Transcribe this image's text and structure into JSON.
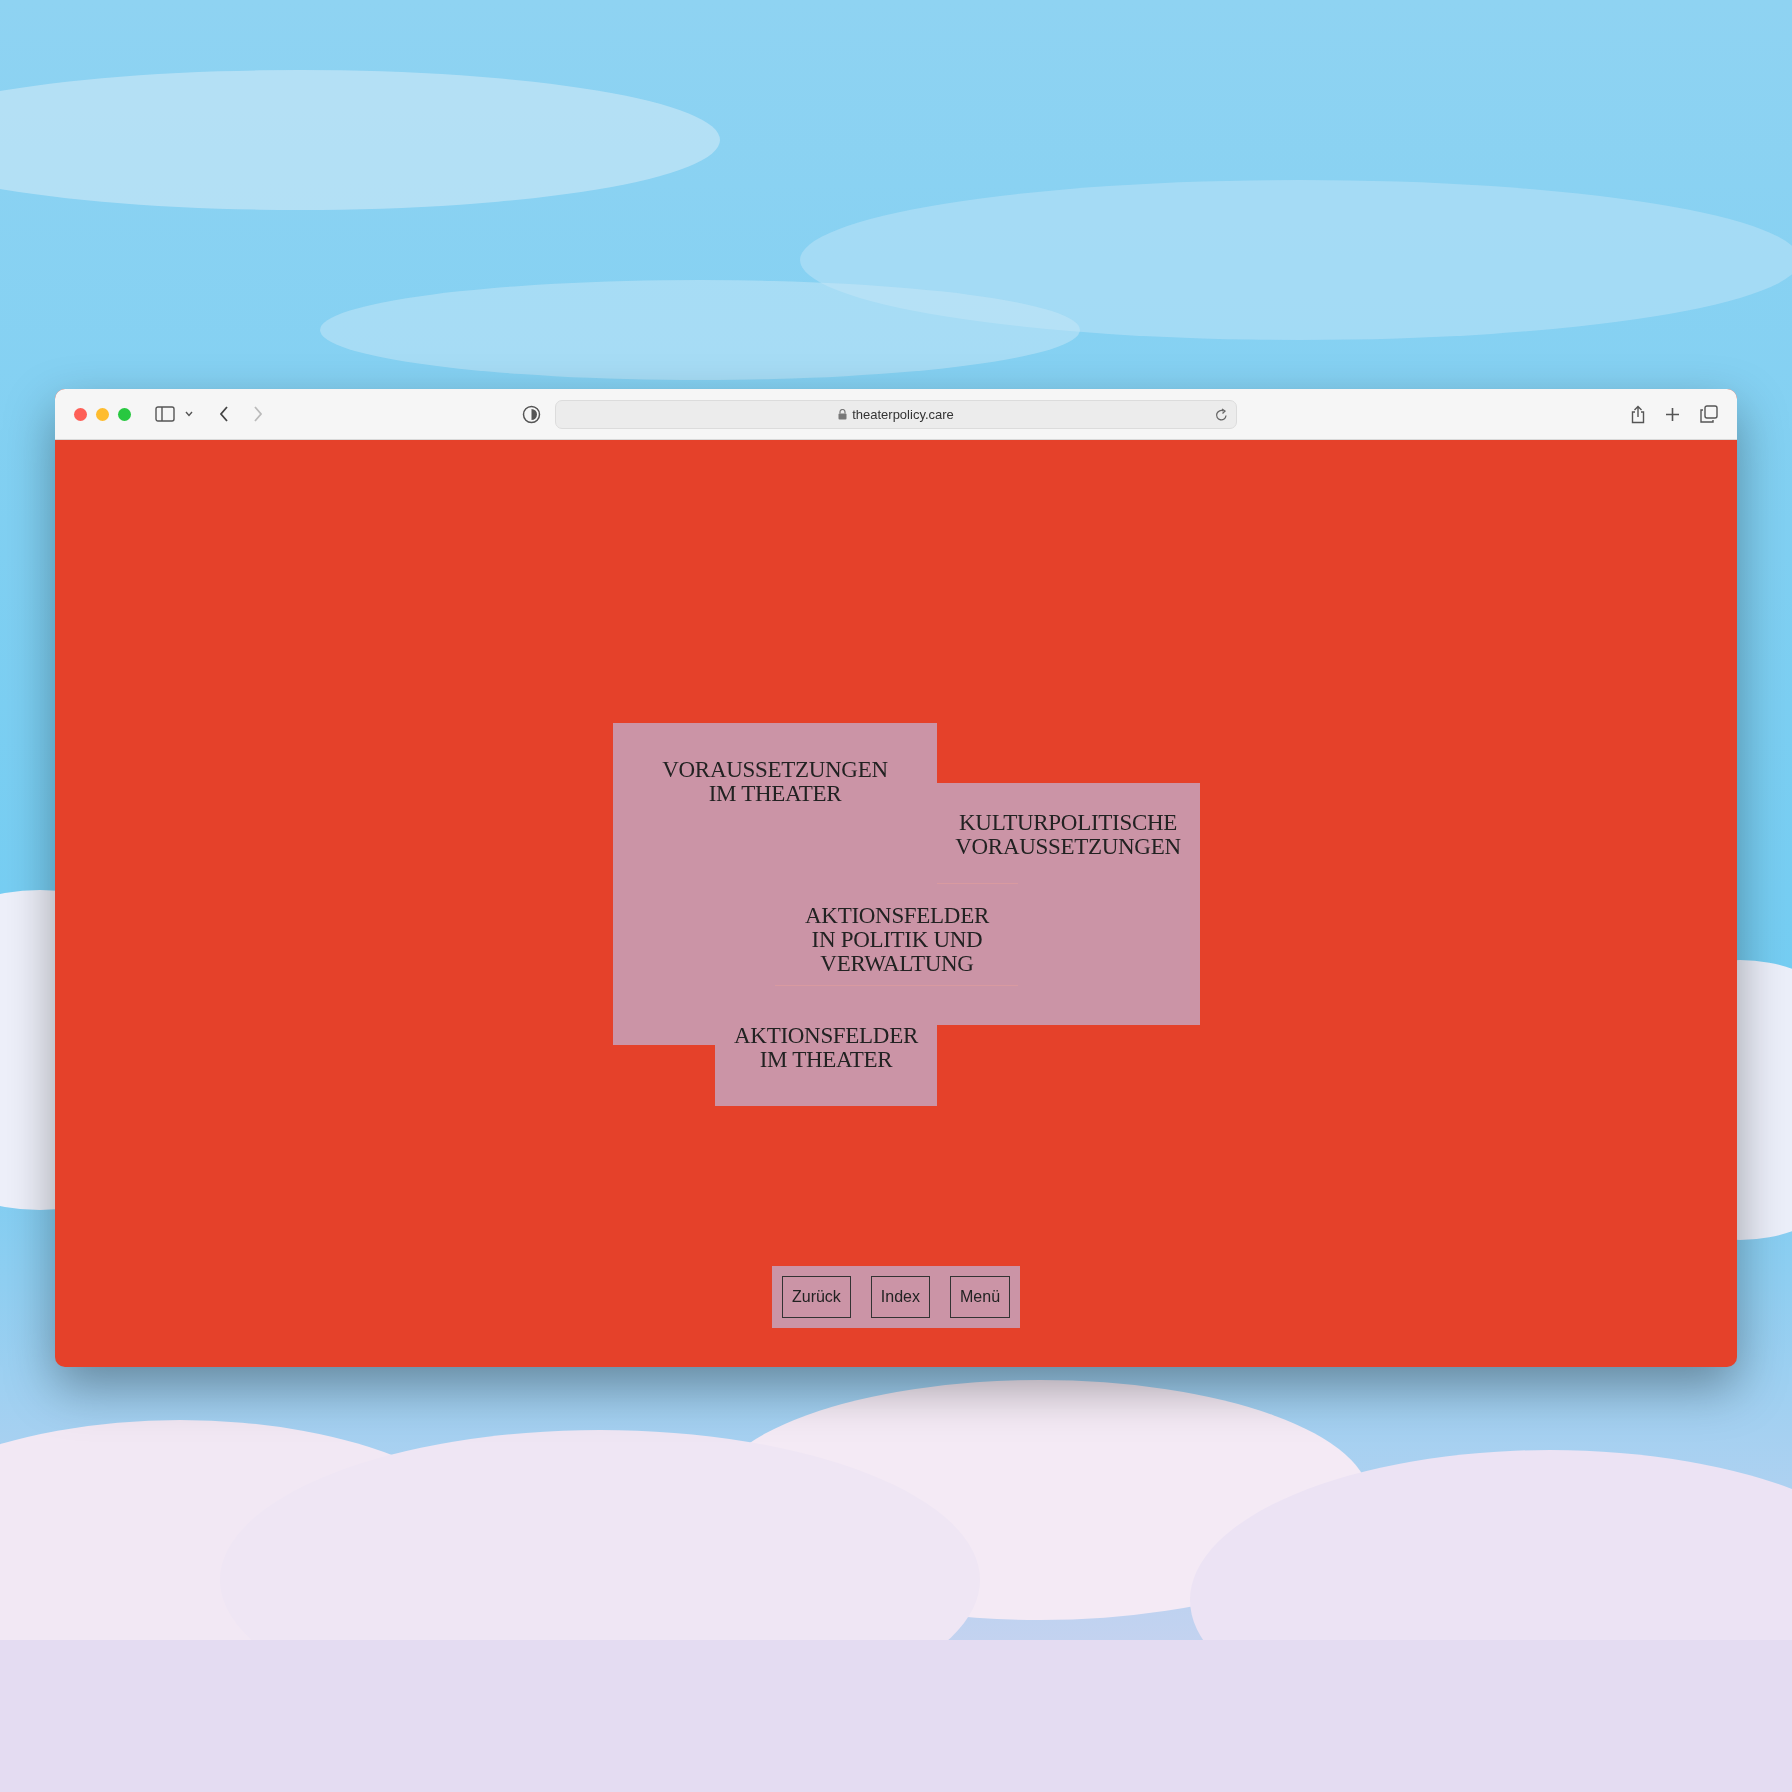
{
  "browser": {
    "url": "theaterpolicy.care"
  },
  "page": {
    "sections": [
      {
        "lines": [
          "VORAUSSETZUNGEN",
          "IM THEATER"
        ]
      },
      {
        "lines": [
          "KULTURPOLITISCHE",
          "VORAUSSETZUNGEN"
        ]
      },
      {
        "lines": [
          "AKTIONSFELDER",
          "IN POLITIK UND",
          "VERWALTUNG"
        ]
      },
      {
        "lines": [
          "AKTIONSFELDER",
          "IM THEATER"
        ]
      }
    ],
    "nav": [
      {
        "label": "Zurück"
      },
      {
        "label": "Index"
      },
      {
        "label": "Menü"
      }
    ]
  }
}
